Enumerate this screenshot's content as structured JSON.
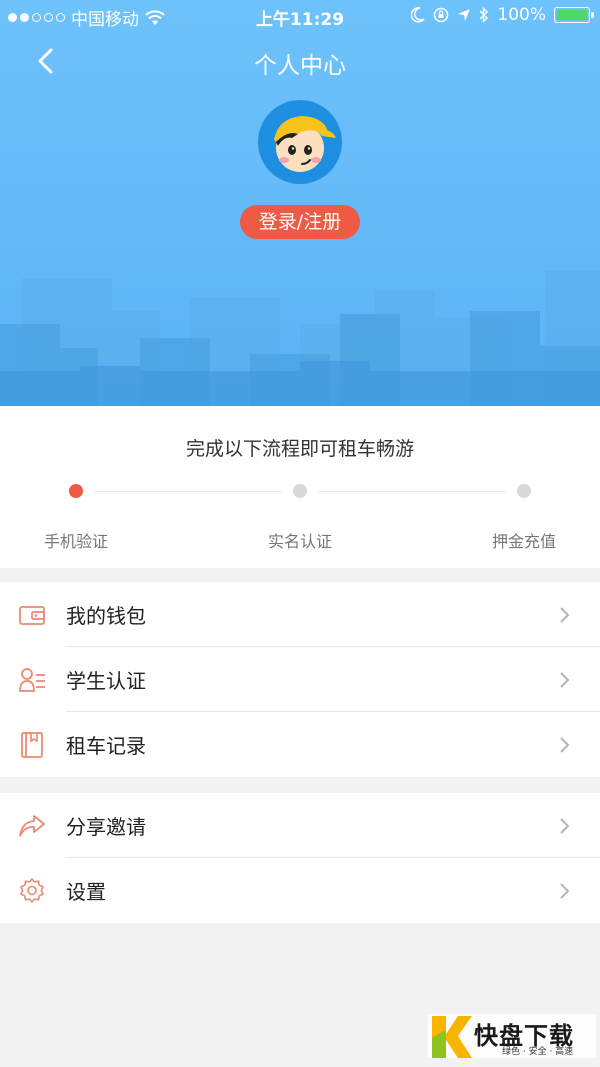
{
  "status_bar": {
    "carrier": "中国移动",
    "time": "上午11:29",
    "battery": "100%"
  },
  "header": {
    "title": "个人中心",
    "login_label": "登录/注册"
  },
  "progress": {
    "title": "完成以下流程即可租车畅游",
    "steps": [
      {
        "label": "手机验证"
      },
      {
        "label": "实名认证"
      },
      {
        "label": "押金充值"
      }
    ]
  },
  "menu_group_1": [
    {
      "label": "我的钱包",
      "icon": "wallet-icon"
    },
    {
      "label": "学生认证",
      "icon": "student-id-icon"
    },
    {
      "label": "租车记录",
      "icon": "record-book-icon"
    }
  ],
  "menu_group_2": [
    {
      "label": "分享邀请",
      "icon": "share-icon"
    },
    {
      "label": "设置",
      "icon": "settings-icon"
    }
  ],
  "watermark": {
    "brand": "快盘下载",
    "slogan": "绿色 · 安全 · 高速"
  },
  "colors": {
    "header_blue": "#6ec2fb",
    "accent_red": "#ef5a45",
    "icon_orange": "#e98a72"
  }
}
